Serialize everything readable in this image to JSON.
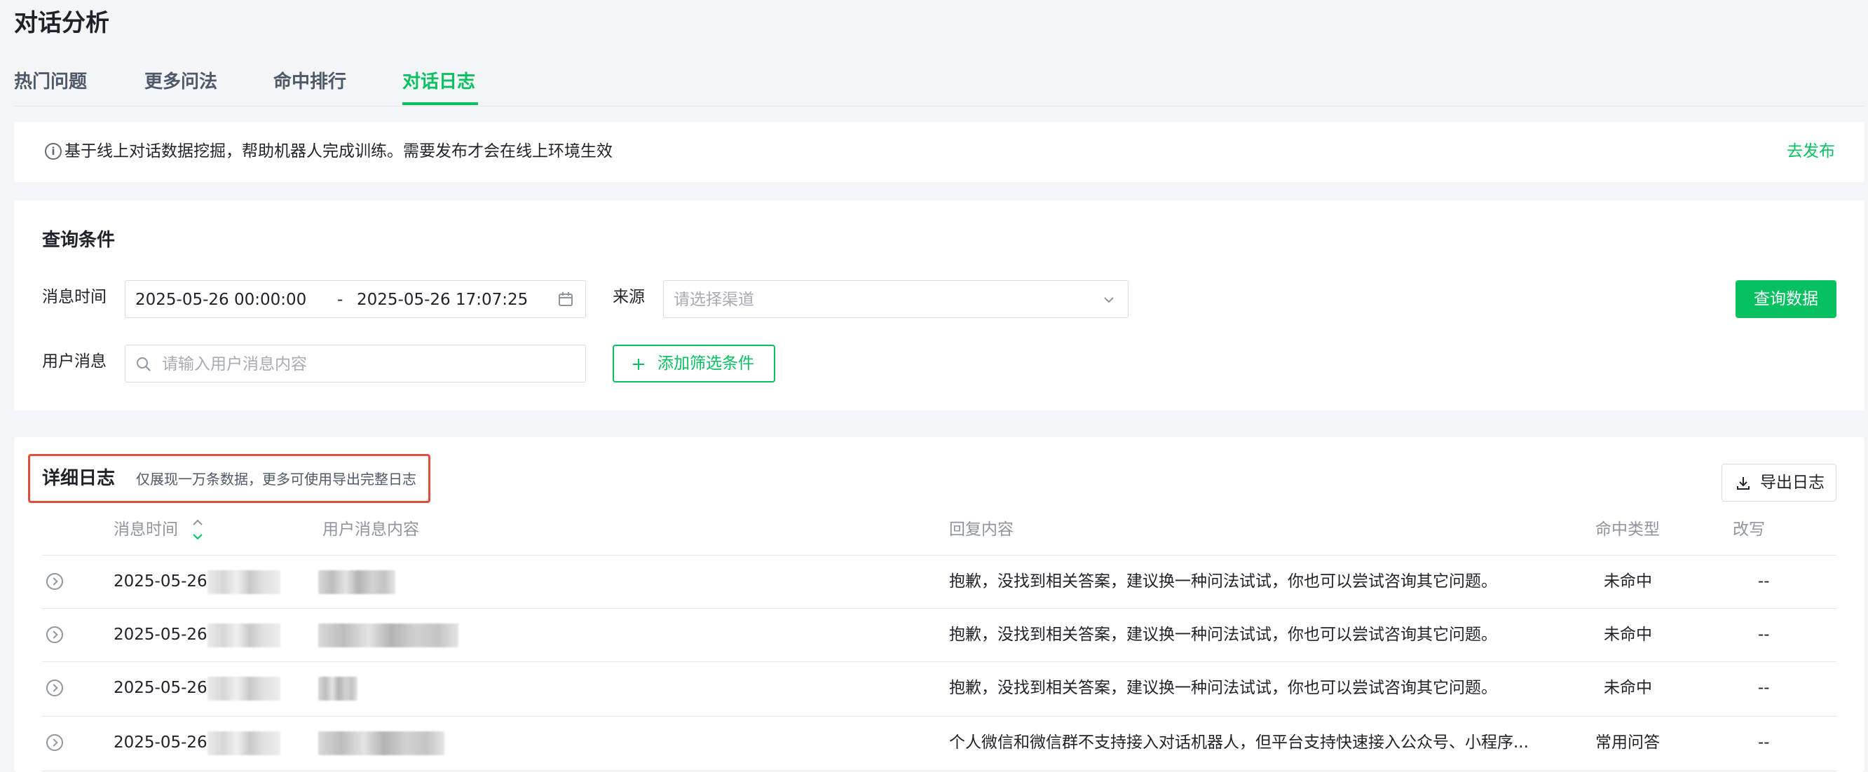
{
  "page": {
    "title": "对话分析"
  },
  "tabs": [
    {
      "label": "热门问题"
    },
    {
      "label": "更多问法"
    },
    {
      "label": "命中排行"
    },
    {
      "label": "对话日志"
    }
  ],
  "active_tab": "对话日志",
  "notice": {
    "text": "基于线上对话数据挖掘，帮助机器人完成训练。需要发布才会在线上环境生效",
    "link": "去发布"
  },
  "query": {
    "title": "查询条件",
    "time_label": "消息时间",
    "start_time": "2025-05-26 00:00:00",
    "separator": "-",
    "end_time": "2025-05-26 17:07:25",
    "source_label": "来源",
    "source_placeholder": "请选择渠道",
    "message_label": "用户消息",
    "message_placeholder": "请输入用户消息内容",
    "add_filter_label": "添加筛选条件",
    "query_button": "查询数据"
  },
  "logs": {
    "title": "详细日志",
    "subtitle": "仅展现一万条数据，更多可使用导出完整日志",
    "export_button": "导出日志",
    "columns": {
      "time": "消息时间",
      "message": "用户消息内容",
      "reply": "回复内容",
      "hit_type": "命中类型",
      "rewrite": "改写"
    },
    "rows": [
      {
        "time": "2025-05-26",
        "reply": "抱歉，没找到相关答案，建议换一种问法试试，你也可以尝试咨询其它问题。",
        "hit_type": "未命中",
        "rewrite": "--"
      },
      {
        "time": "2025-05-26",
        "reply": "抱歉，没找到相关答案，建议换一种问法试试，你也可以尝试咨询其它问题。",
        "hit_type": "未命中",
        "rewrite": "--"
      },
      {
        "time": "2025-05-26",
        "reply": "抱歉，没找到相关答案，建议换一种问法试试，你也可以尝试咨询其它问题。",
        "hit_type": "未命中",
        "rewrite": "--"
      },
      {
        "time": "2025-05-26",
        "reply": "个人微信和微信群不支持接入对话机器人，但平台支持快速接入公众号、小程序...",
        "hit_type": "常用问答",
        "rewrite": "--"
      }
    ]
  },
  "colors": {
    "accent": "#07c160",
    "highlight_border": "#e24d3d"
  },
  "icons": [
    "info-icon",
    "calendar-icon",
    "chevron-down-icon",
    "search-icon",
    "plus-icon",
    "download-icon",
    "sort-icon",
    "expand-row-icon"
  ]
}
